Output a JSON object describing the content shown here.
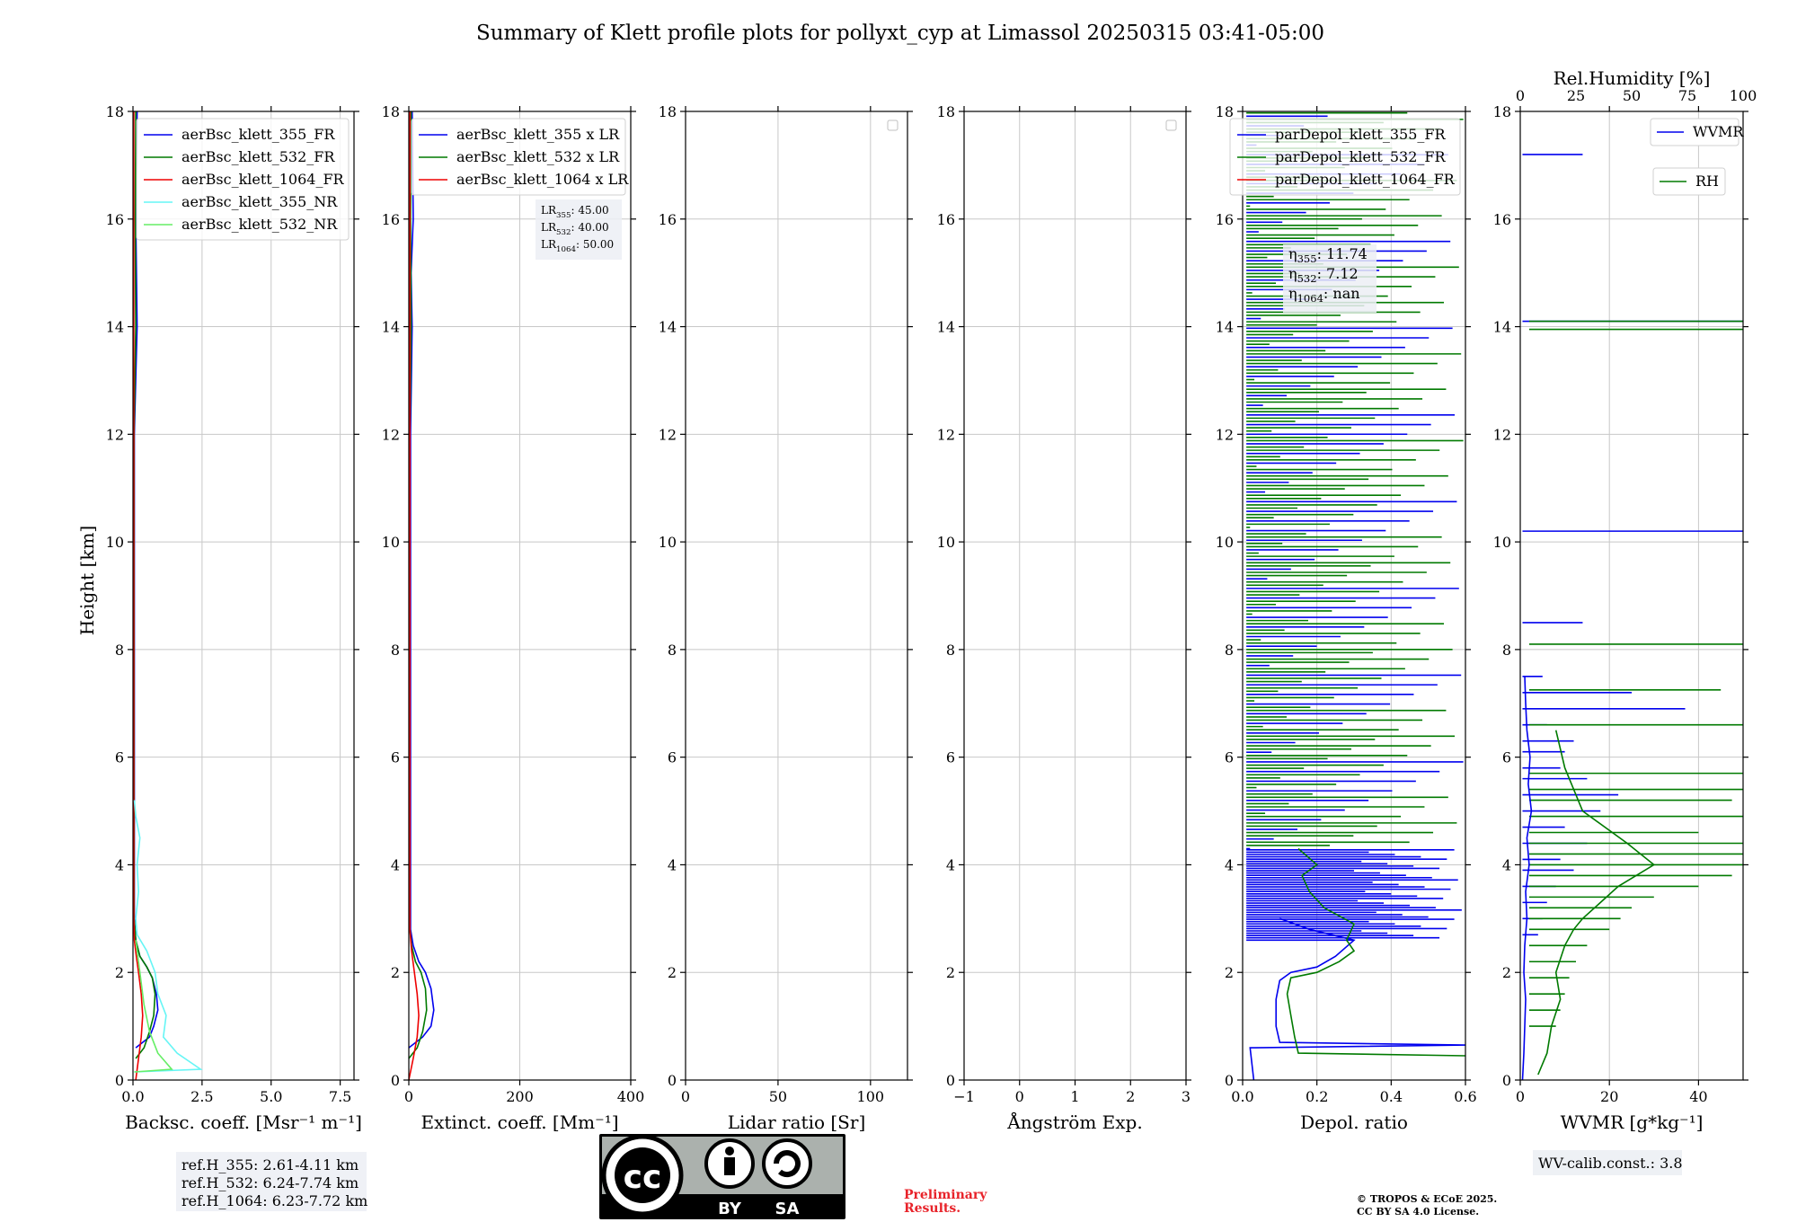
{
  "title": "Summary of Klett profile plots for pollyxt_cyp at Limassol 20250315 03:41-05:00",
  "ylabel": "Height [km]",
  "colors": {
    "blue": "#0000ee",
    "green": "#007a00",
    "red": "#ee0000",
    "cyan": "#66f5f5",
    "lightgreen": "#66ee66"
  },
  "chart_data": [
    {
      "type": "line",
      "xlabel": "Backsc. coeff. [Msr⁻¹ m⁻¹]",
      "xlim": [
        0,
        8
      ],
      "ylim": [
        0,
        18
      ],
      "xticks": [
        0,
        2.5,
        5,
        7.5
      ],
      "xtick_labels": [
        "0.0",
        "2.5",
        "5.0",
        "7.5"
      ],
      "yticks": [
        0,
        2,
        4,
        6,
        8,
        10,
        12,
        14,
        16,
        18
      ],
      "legend_position": "top-right",
      "series": [
        {
          "name": "aerBsc_klett_355_FR",
          "color": "#0000ee",
          "x": [
            0.1,
            0.6,
            0.75,
            0.9,
            0.85,
            0.7,
            0.5,
            0.25,
            0.1,
            0.05,
            0.05,
            0.05,
            0.05,
            0.15,
            0.1,
            0.15
          ],
          "y": [
            0.6,
            0.8,
            1.0,
            1.3,
            1.6,
            1.9,
            2.1,
            2.3,
            2.6,
            3.0,
            5.0,
            8.0,
            12.0,
            14.0,
            16.0,
            18.0
          ]
        },
        {
          "name": "aerBsc_klett_532_FR",
          "color": "#007a00",
          "x": [
            0.1,
            0.4,
            0.6,
            0.75,
            0.8,
            0.7,
            0.5,
            0.25,
            0.1,
            0.04,
            0.04,
            0.04,
            0.04,
            0.1,
            0.08,
            0.1
          ],
          "y": [
            0.4,
            0.6,
            0.9,
            1.2,
            1.6,
            1.9,
            2.1,
            2.3,
            2.6,
            3.0,
            5.0,
            8.0,
            12.0,
            14.0,
            16.0,
            18.0
          ]
        },
        {
          "name": "aerBsc_klett_1064_FR",
          "color": "#ee0000",
          "x": [
            0.1,
            0.2,
            0.3,
            0.35,
            0.3,
            0.2,
            0.12,
            0.05,
            0.03,
            0.03,
            0.03,
            0.03,
            0.03
          ],
          "y": [
            0.0,
            0.4,
            0.8,
            1.2,
            1.6,
            2.0,
            2.3,
            2.6,
            3.0,
            5.0,
            8.0,
            12.0,
            18.0
          ]
        },
        {
          "name": "aerBsc_klett_355_NR",
          "color": "#66f5f5",
          "x": [
            0.05,
            2.45,
            1.6,
            1.1,
            1.2,
            0.9,
            0.8,
            0.5,
            0.15,
            0.1,
            0.2,
            0.15,
            0.25,
            0.1,
            0.05
          ],
          "y": [
            0.15,
            0.2,
            0.5,
            0.8,
            1.2,
            1.6,
            2.0,
            2.4,
            2.7,
            3.0,
            3.5,
            4.0,
            4.5,
            4.9,
            5.2
          ]
        },
        {
          "name": "aerBsc_klett_532_NR",
          "color": "#66ee66",
          "x": [
            0.05,
            1.4,
            0.9,
            0.6,
            0.4,
            0.25,
            0.1
          ],
          "y": [
            0.15,
            0.2,
            0.5,
            0.9,
            1.4,
            2.0,
            2.6
          ]
        }
      ]
    },
    {
      "type": "line",
      "xlabel": "Extinct. coeff. [Mm⁻¹]",
      "xlim": [
        0,
        400
      ],
      "ylim": [
        0,
        18
      ],
      "xticks": [
        0,
        200,
        400
      ],
      "xtick_labels": [
        "0",
        "200",
        "400"
      ],
      "yticks": [
        0,
        2,
        4,
        6,
        8,
        10,
        12,
        14,
        16,
        18
      ],
      "legend_position": "top-right",
      "annotation": [
        {
          "pre": "LR",
          "sub": "355",
          "post": ": 45.00"
        },
        {
          "pre": "LR",
          "sub": "532",
          "post": ": 40.00"
        },
        {
          "pre": "LR",
          "sub": "1064",
          "post": ": 50.00"
        }
      ],
      "series": [
        {
          "name": "aerBsc_klett_355 x LR",
          "color": "#0000ee",
          "x": [
            0,
            25,
            40,
            45,
            40,
            30,
            18,
            8,
            3,
            3,
            3,
            3,
            6,
            4,
            8,
            6
          ],
          "y": [
            0.6,
            0.8,
            1.0,
            1.3,
            1.7,
            2.0,
            2.2,
            2.5,
            2.8,
            4.0,
            8.0,
            12.0,
            14.0,
            15.0,
            16.0,
            18.0
          ]
        },
        {
          "name": "aerBsc_klett_532 x LR",
          "color": "#007a00",
          "x": [
            0,
            15,
            25,
            32,
            30,
            22,
            12,
            5,
            2,
            2,
            2,
            2,
            4,
            3,
            4
          ],
          "y": [
            0.4,
            0.6,
            0.9,
            1.3,
            1.7,
            2.0,
            2.2,
            2.5,
            2.8,
            4.0,
            8.0,
            12.0,
            14.0,
            16.0,
            18.0
          ]
        },
        {
          "name": "aerBsc_klett_1064 x LR",
          "color": "#ee0000",
          "x": [
            0,
            8,
            15,
            18,
            15,
            10,
            5,
            2,
            2,
            2
          ],
          "y": [
            0.0,
            0.4,
            0.8,
            1.2,
            1.6,
            2.0,
            2.4,
            2.8,
            8.0,
            18.0
          ]
        }
      ]
    },
    {
      "type": "line",
      "xlabel": "Lidar ratio [Sr]",
      "xlim": [
        0,
        120
      ],
      "ylim": [
        0,
        18
      ],
      "xticks": [
        0,
        50,
        100
      ],
      "xtick_labels": [
        "0",
        "50",
        "100"
      ],
      "yticks": [
        0,
        2,
        4,
        6,
        8,
        10,
        12,
        14,
        16,
        18
      ],
      "series": []
    },
    {
      "type": "line",
      "xlabel": "Ångström Exp.",
      "xlim": [
        -1,
        3
      ],
      "ylim": [
        0,
        18
      ],
      "xticks": [
        -1,
        0,
        1,
        2,
        3
      ],
      "xtick_labels": [
        "−1",
        "0",
        "1",
        "2",
        "3"
      ],
      "yticks": [
        0,
        2,
        4,
        6,
        8,
        10,
        12,
        14,
        16,
        18
      ],
      "series": []
    },
    {
      "type": "line",
      "xlabel": "Depol. ratio",
      "xlim": [
        0,
        0.6
      ],
      "ylim": [
        0,
        18
      ],
      "xticks": [
        0,
        0.2,
        0.4,
        0.6
      ],
      "xtick_labels": [
        "0.0",
        "0.2",
        "0.4",
        "0.6"
      ],
      "yticks": [
        0,
        2,
        4,
        6,
        8,
        10,
        12,
        14,
        16,
        18
      ],
      "legend_position": "top-right",
      "annotation": [
        {
          "pre": "η",
          "sub": "355",
          "post": ": 11.74"
        },
        {
          "pre": "η",
          "sub": "532",
          "post": ": 7.12"
        },
        {
          "pre": "η",
          "sub": "1064",
          "post": ": nan"
        }
      ],
      "series": [
        {
          "name": "parDepol_klett_355_FR",
          "color": "#0000ee",
          "x": [
            0.03,
            0.02,
            0.6,
            0.1,
            0.09,
            0.09,
            0.1,
            0.13,
            0.2,
            0.25,
            0.3,
            0.18,
            0.1
          ],
          "y": [
            0.0,
            0.6,
            0.65,
            0.7,
            1.0,
            1.5,
            1.85,
            2.0,
            2.1,
            2.3,
            2.6,
            2.8,
            3.0
          ]
        },
        {
          "name": "parDepol_klett_532_FR",
          "color": "#007a00",
          "x": [
            0.6,
            0.15,
            0.14,
            0.13,
            0.12,
            0.13,
            0.2,
            0.26,
            0.3,
            0.28,
            0.3,
            0.22,
            0.18,
            0.16,
            0.2,
            0.15
          ],
          "y": [
            0.45,
            0.5,
            0.8,
            1.2,
            1.6,
            1.9,
            2.0,
            2.2,
            2.4,
            2.6,
            2.9,
            3.2,
            3.5,
            3.8,
            4.0,
            4.3
          ]
        },
        {
          "name": "parDepol_klett_1064_FR",
          "color": "#ee0000",
          "x": [],
          "y": []
        }
      ]
    },
    {
      "type": "line",
      "xlabel": "WVMR [g*kg⁻¹]",
      "top_xlabel": "Rel.Humidity [%]",
      "xlim": [
        0,
        50
      ],
      "ylim": [
        0,
        18
      ],
      "xticks": [
        0,
        20,
        40
      ],
      "xtick_labels": [
        "0",
        "20",
        "40"
      ],
      "top_xlim": [
        0,
        100
      ],
      "top_xticks": [
        0,
        25,
        50,
        75,
        100
      ],
      "top_xtick_labels": [
        "0",
        "25",
        "50",
        "75",
        "100"
      ],
      "yticks": [
        0,
        2,
        4,
        6,
        8,
        10,
        12,
        14,
        16,
        18
      ],
      "series": [
        {
          "name": "WVMR",
          "color": "#0000ee",
          "x": [
            0.5,
            0.8,
            1.0,
            1.2,
            0.8,
            1.0,
            1.5,
            1.2,
            2.0,
            1.5,
            2.5,
            1.8,
            2.2,
            1.5,
            1.2,
            1.0
          ],
          "y": [
            0.0,
            0.5,
            1.0,
            1.5,
            2.0,
            2.5,
            3.0,
            3.5,
            4.0,
            4.5,
            5.0,
            5.5,
            6.0,
            6.5,
            7.0,
            7.5
          ]
        },
        {
          "name": "RH",
          "color": "#007a00",
          "x": [
            4,
            6,
            7,
            9,
            8,
            10,
            12,
            14,
            18,
            22,
            26,
            30,
            24,
            14,
            10,
            8
          ],
          "y": [
            0.1,
            0.5,
            1.0,
            1.5,
            2.0,
            2.5,
            2.8,
            3.0,
            3.3,
            3.6,
            3.8,
            4.0,
            4.4,
            5.0,
            5.8,
            6.5
          ]
        }
      ]
    }
  ],
  "ref_box": [
    "ref.H_355: 2.61-4.11 km",
    "ref.H_532: 6.24-7.74 km",
    "ref.H_1064: 6.23-7.72 km"
  ],
  "wv_calib": "WV-calib.const.: 3.8",
  "license_badge": {
    "by": "BY",
    "sa": "SA",
    "cc": "cc"
  },
  "preliminary": [
    "Preliminary",
    "Results."
  ],
  "copyright": [
    "© TROPOS & ECoE 2025.",
    "CC BY SA 4.0 License."
  ]
}
